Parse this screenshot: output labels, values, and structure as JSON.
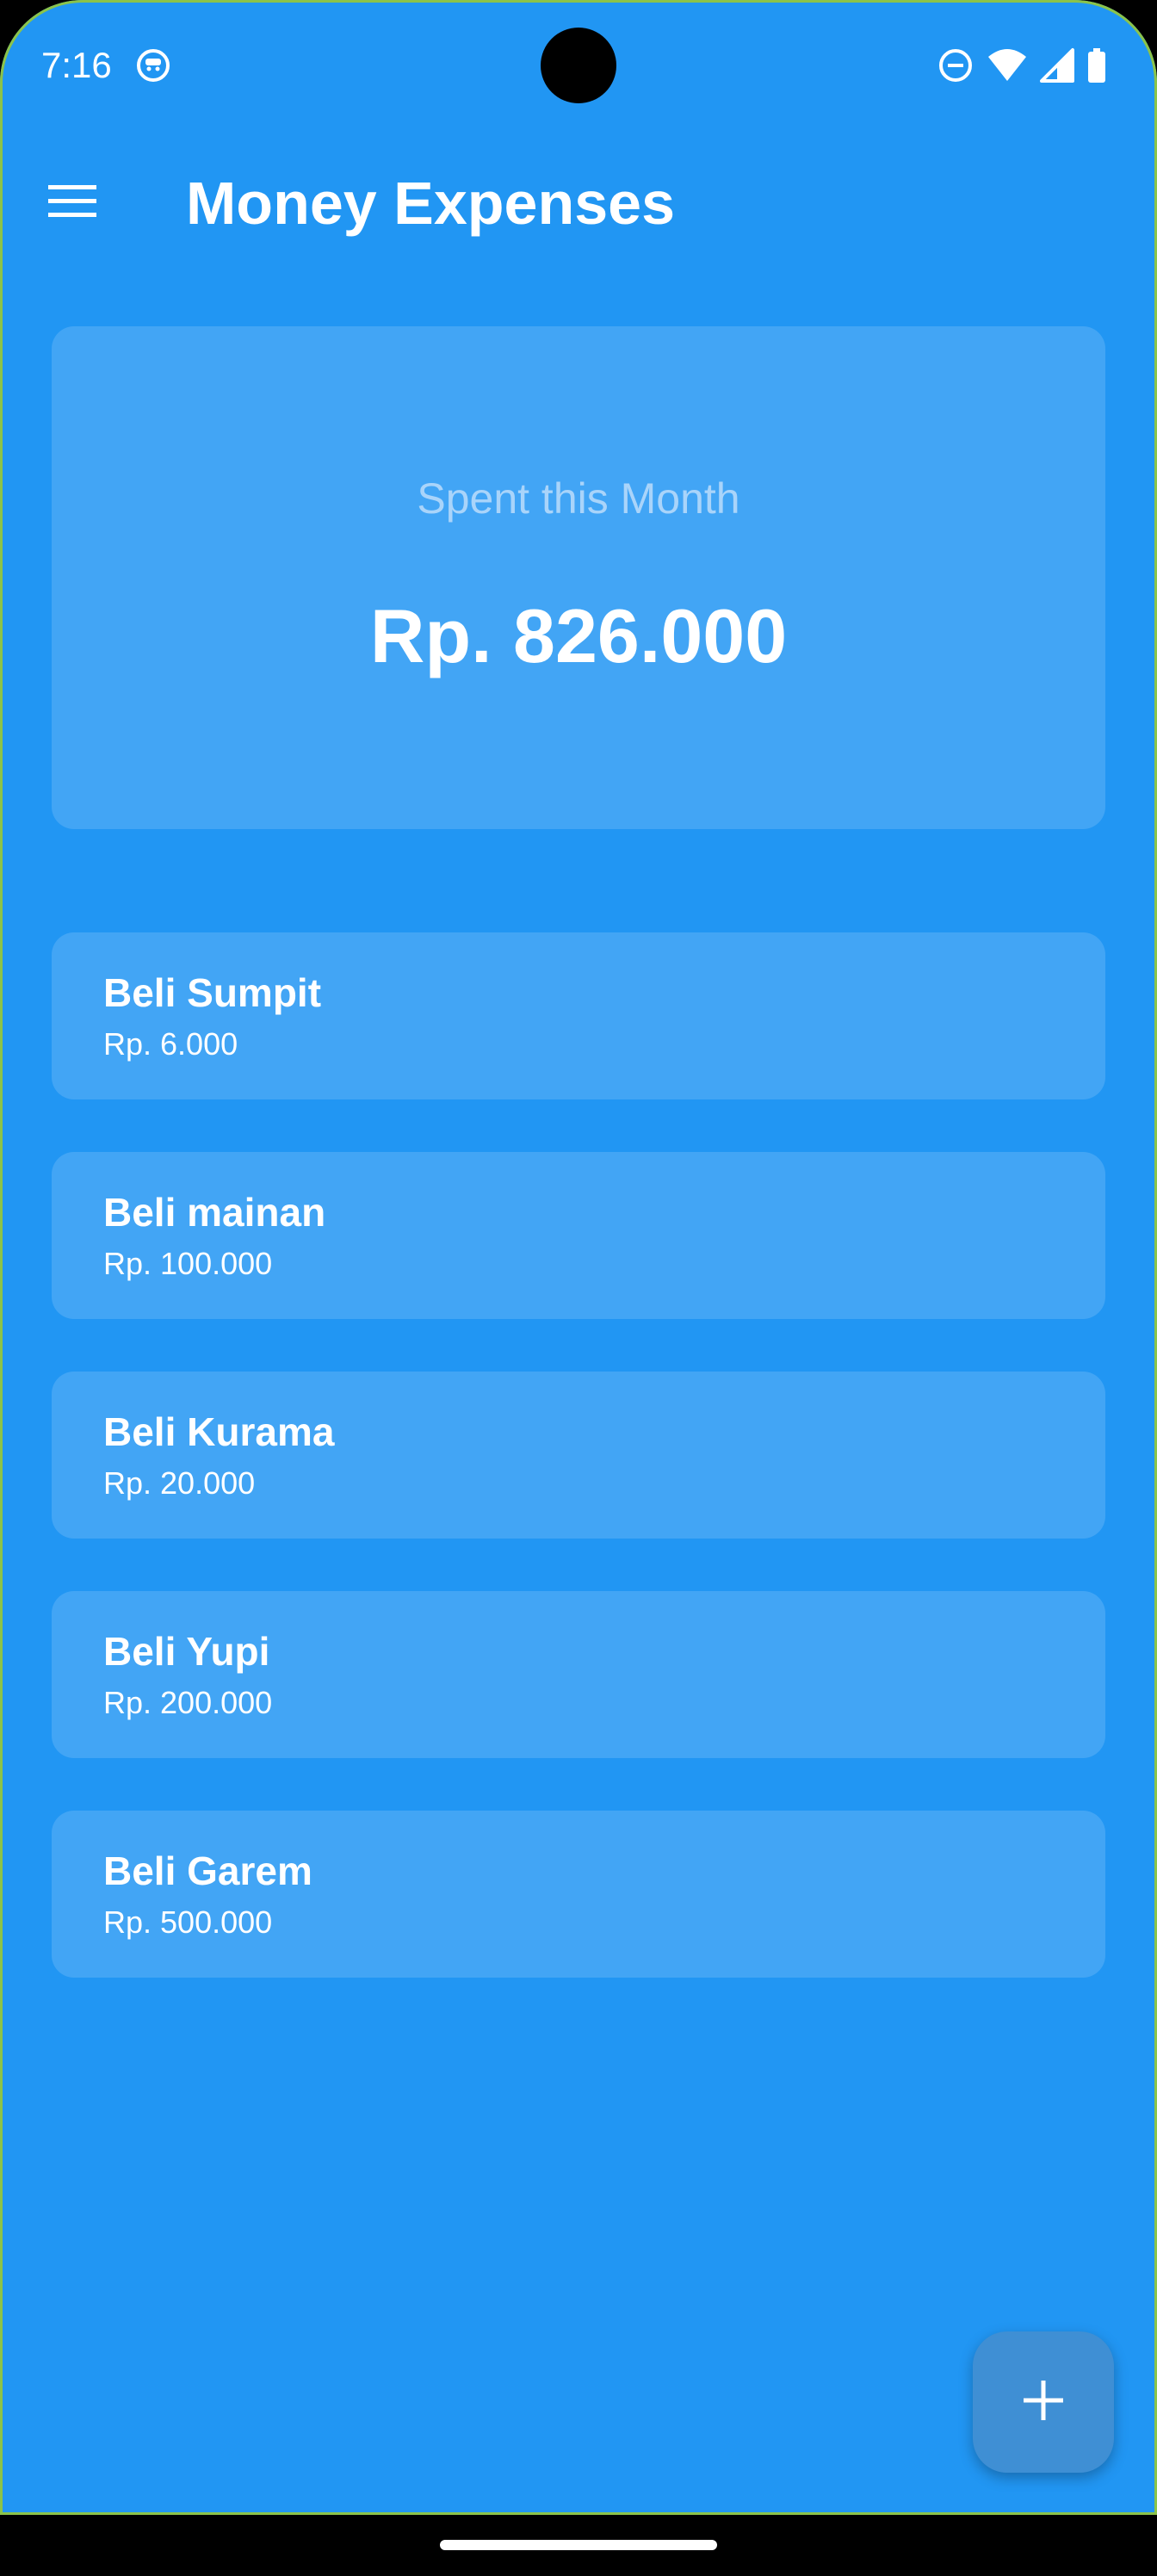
{
  "status_bar": {
    "time": "7:16",
    "icons": [
      "app-notification-icon",
      "do-not-disturb-icon",
      "wifi-icon",
      "cellular-signal-icon",
      "battery-icon"
    ]
  },
  "app_bar": {
    "title": "Money Expenses",
    "menu_icon": "hamburger-menu-icon"
  },
  "summary": {
    "label": "Spent this Month",
    "amount": "Rp. 826.000"
  },
  "expenses": [
    {
      "name": "Beli Sumpit",
      "amount": "Rp. 6.000"
    },
    {
      "name": "Beli mainan",
      "amount": "Rp. 100.000"
    },
    {
      "name": "Beli Kurama",
      "amount": "Rp. 20.000"
    },
    {
      "name": "Beli Yupi",
      "amount": "Rp. 200.000"
    },
    {
      "name": "Beli Garem",
      "amount": "Rp. 500.000"
    }
  ],
  "fab": {
    "icon": "plus-icon"
  },
  "colors": {
    "background": "#2196f3",
    "card": "#42a5f5",
    "fab": "#3f8fd4",
    "text_primary": "#ffffff",
    "text_muted": "#a9d4fa"
  }
}
